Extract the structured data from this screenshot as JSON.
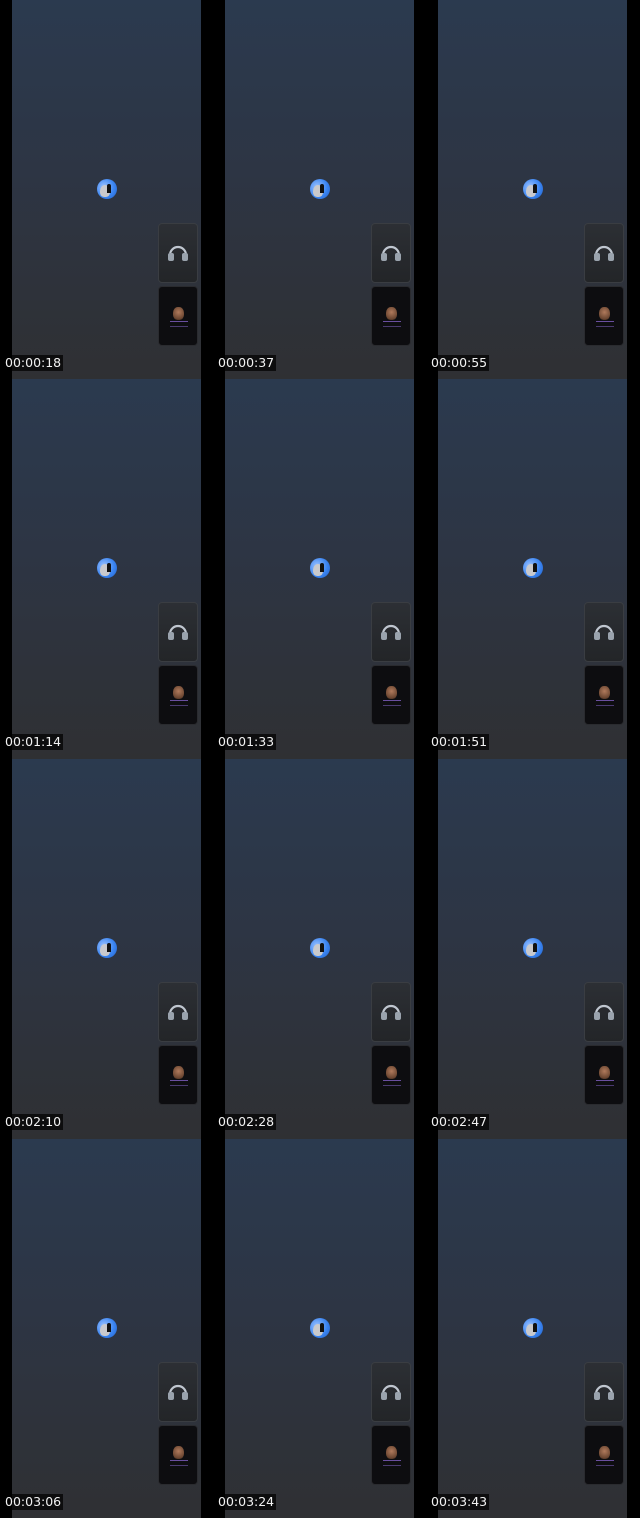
{
  "thumbnails": [
    {
      "timestamp": "00:00:18"
    },
    {
      "timestamp": "00:00:37"
    },
    {
      "timestamp": "00:00:55"
    },
    {
      "timestamp": "00:01:14"
    },
    {
      "timestamp": "00:01:33"
    },
    {
      "timestamp": "00:01:51"
    },
    {
      "timestamp": "00:02:10"
    },
    {
      "timestamp": "00:02:28"
    },
    {
      "timestamp": "00:02:47"
    },
    {
      "timestamp": "00:03:06"
    },
    {
      "timestamp": "00:03:24"
    },
    {
      "timestamp": "00:03:43"
    }
  ],
  "icons": {
    "center_avatar": "moon-avatar-icon",
    "top_side_button": "headphones-icon",
    "bottom_side_button": "profile-thumbnail"
  },
  "colors": {
    "accent_blue": "#3c86f2",
    "background_top": "#2b3a4f",
    "background_bottom": "#2f3033",
    "timestamp_text": "#f2f2f2"
  }
}
